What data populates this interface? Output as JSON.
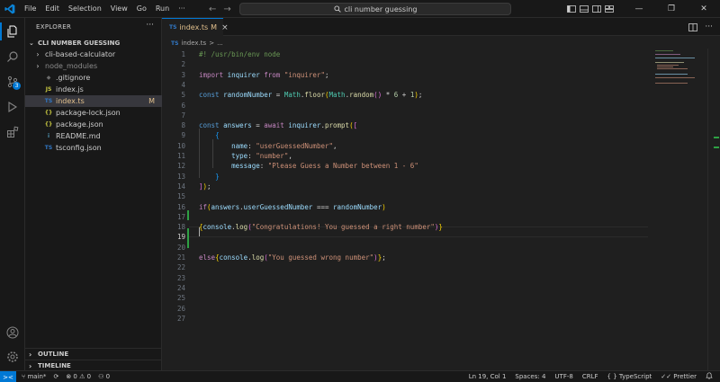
{
  "titlebar": {
    "menu": [
      "File",
      "Edit",
      "Selection",
      "View",
      "Go",
      "Run"
    ],
    "more": "···",
    "search_text": "cli number guessing",
    "back_arrow": "←",
    "forward_arrow": "→"
  },
  "sidebar": {
    "header": "EXPLORER",
    "more": "···",
    "folder": "CLI NUMBER GUESSING",
    "items": [
      {
        "name": "cli-based-calculator",
        "type": "folder",
        "icon": ""
      },
      {
        "name": "node_modules",
        "type": "folder",
        "icon": ""
      },
      {
        "name": ".gitignore",
        "type": "file",
        "icon": "◆"
      },
      {
        "name": "index.js",
        "type": "file",
        "icon": "JS"
      },
      {
        "name": "index.ts",
        "type": "file",
        "icon": "TS",
        "flag": "M"
      },
      {
        "name": "package-lock.json",
        "type": "file",
        "icon": "{}"
      },
      {
        "name": "package.json",
        "type": "file",
        "icon": "{}"
      },
      {
        "name": "README.md",
        "type": "file",
        "icon": "i"
      },
      {
        "name": "tsconfig.json",
        "type": "file",
        "icon": "TS"
      }
    ],
    "outline": "OUTLINE",
    "timeline": "TIMELINE"
  },
  "tab": {
    "icon": "TS",
    "name": "index.ts",
    "modified": "M",
    "close": "×"
  },
  "breadcrumb": {
    "icon": "TS",
    "file": "index.ts",
    "sep": ">",
    "rest": "..."
  },
  "editor": {
    "line_numbers": [
      "1",
      "2",
      "3",
      "4",
      "5",
      "6",
      "7",
      "8",
      "9",
      "10",
      "11",
      "12",
      "13",
      "14",
      "15",
      "16",
      "17",
      "18",
      "19",
      "20",
      "21",
      "22",
      "23",
      "24",
      "25",
      "26",
      "27"
    ],
    "current_line": "19",
    "lines": [
      "#! /usr/bin/env node",
      "",
      "import inquirer from \"inquirer\";",
      "",
      "const randomNumber = Math.floor(Math.random() * 6 + 1);",
      "",
      "",
      "const answers = await inquirer.prompt([",
      "    {",
      "        name: \"userGuessedNumber\",",
      "        type: \"number\",",
      "        message: \"Please Guess a Number between 1 - 6\"",
      "    }",
      "]);",
      "",
      "if(answers.userGuessedNumber === randomNumber)",
      "",
      "{console.log(\"Congratulations! You guessed a right number\")}",
      "",
      "",
      "else{console.log(\"You guessed wrong number\")};"
    ]
  },
  "statusbar": {
    "remote": "><",
    "branch": "main*",
    "sync": "⟳",
    "errors": "0",
    "warnings": "0",
    "ports": "0",
    "position": "Ln 19, Col 1",
    "spaces": "Spaces: 4",
    "encoding": "UTF-8",
    "eol": "CRLF",
    "language": "TypeScript",
    "language_brace": "{ }",
    "prettier": "Prettier",
    "bell": "🔔"
  },
  "colors": {
    "accent": "#0078d4",
    "modified": "#e2c08d",
    "added": "#2ea043"
  }
}
